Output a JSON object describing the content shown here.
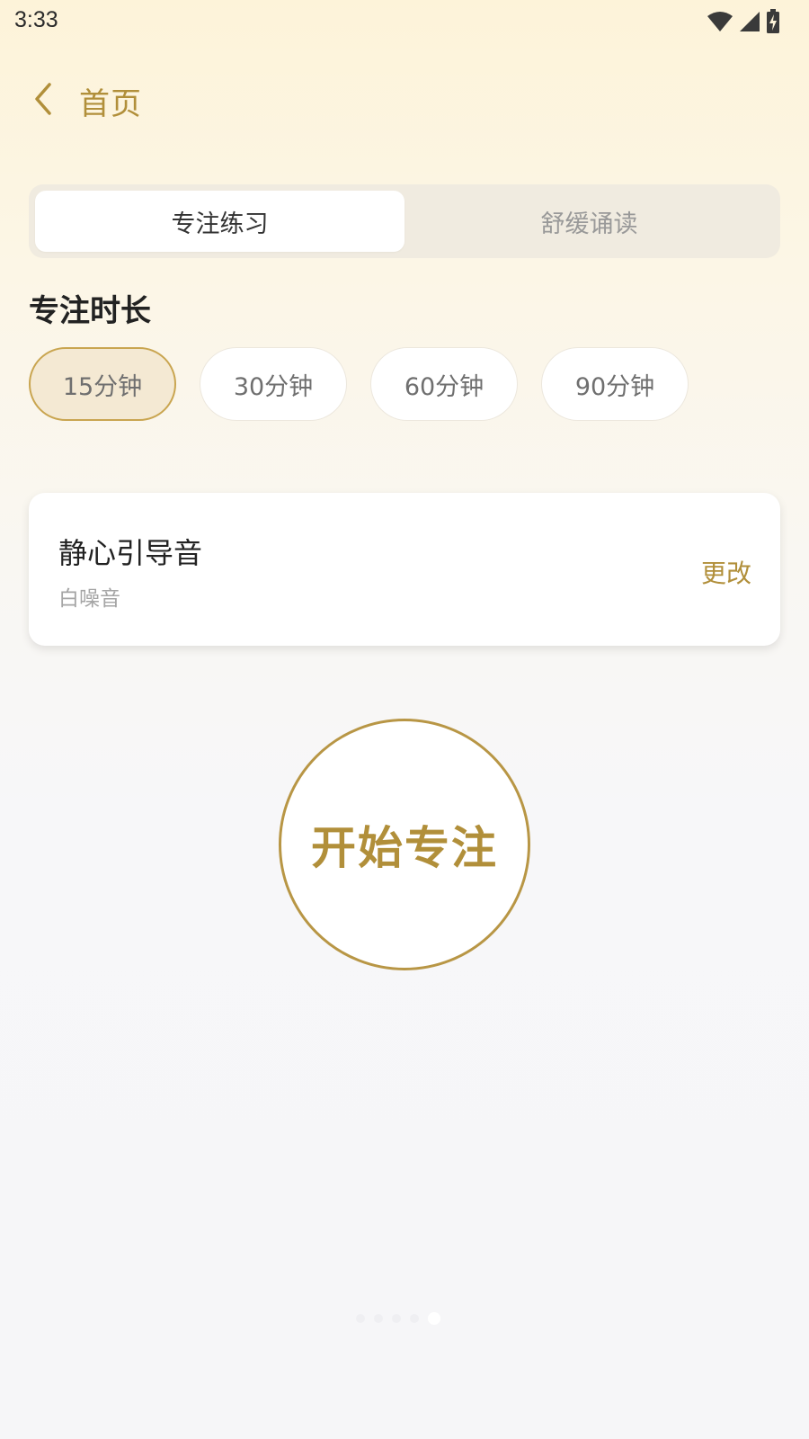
{
  "status_bar": {
    "time": "3:33",
    "icons": [
      "wifi-icon",
      "signal-icon",
      "battery-charging-icon"
    ]
  },
  "header": {
    "back_icon": "chevron-left-icon",
    "title": "首页"
  },
  "tabs": [
    {
      "label": "专注练习",
      "active": true
    },
    {
      "label": "舒缓诵读",
      "active": false
    }
  ],
  "duration": {
    "title": "专注时长",
    "options": [
      {
        "label": "15分钟",
        "selected": true
      },
      {
        "label": "30分钟",
        "selected": false
      },
      {
        "label": "60分钟",
        "selected": false
      },
      {
        "label": "90分钟",
        "selected": false
      }
    ]
  },
  "sound": {
    "title": "静心引导音",
    "subtitle": "白噪音",
    "change_label": "更改"
  },
  "start": {
    "label": "开始专注"
  },
  "pager": {
    "count": 5,
    "active_index": 4
  },
  "colors": {
    "accent": "#b18f3a",
    "accent_border": "#b89645",
    "selected_chip_bg": "#f4e9d3",
    "tab_track_bg": "#f0ebe0"
  }
}
